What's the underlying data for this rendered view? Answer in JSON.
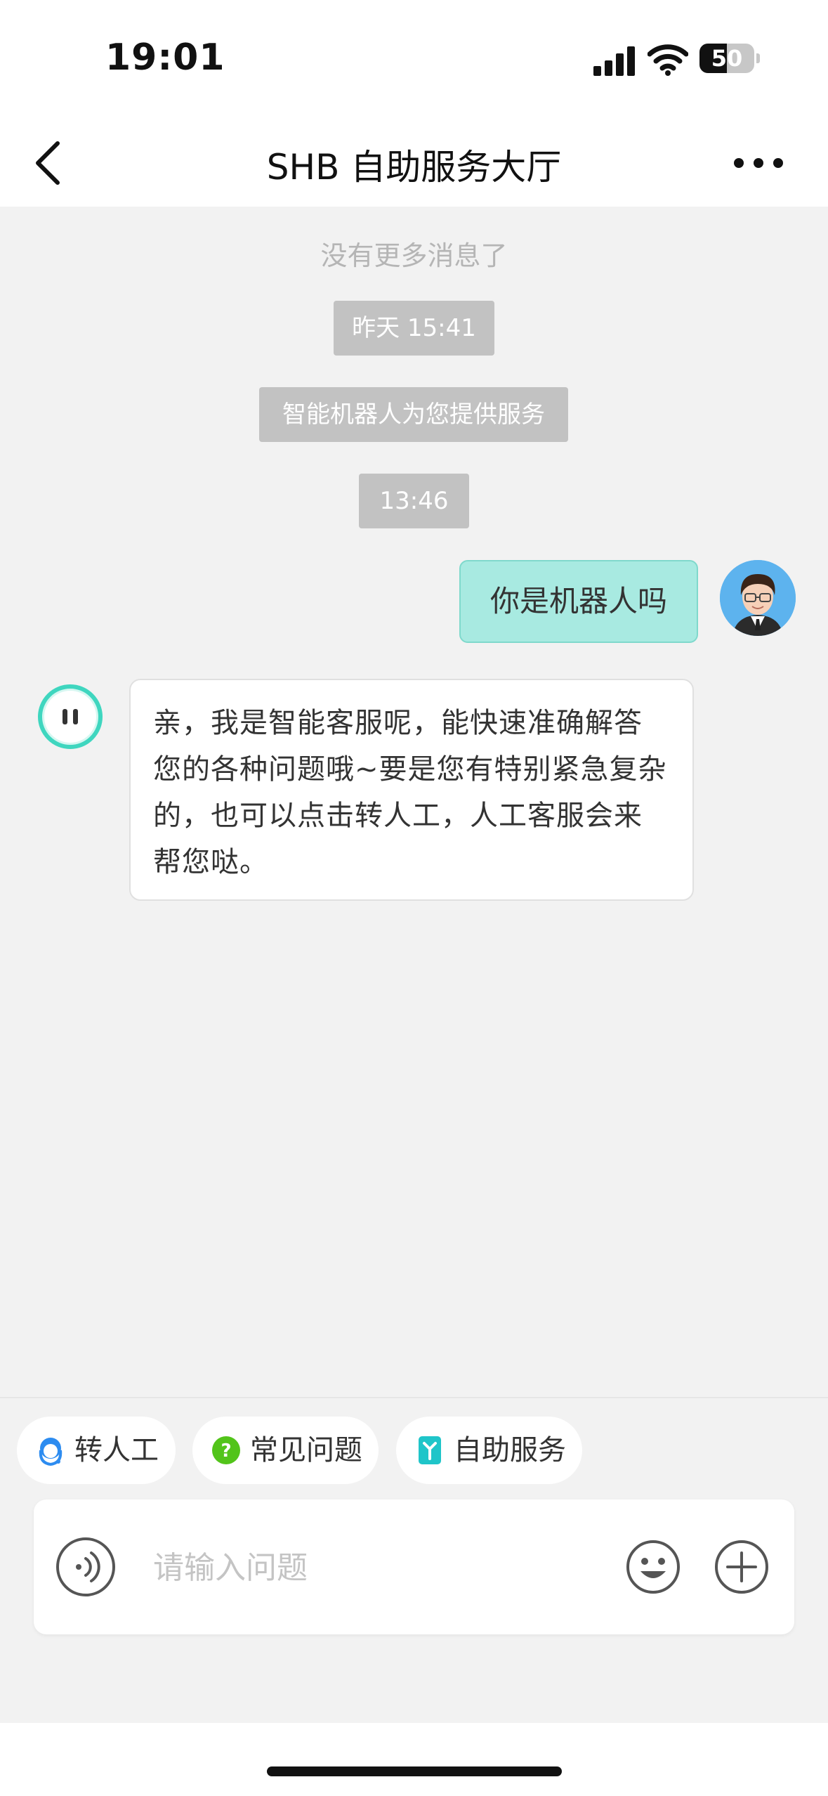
{
  "status_bar": {
    "time": "19:01",
    "battery": "50",
    "battery_level": 0.5
  },
  "navbar": {
    "title": "SHB 自助服务大厅",
    "back_icon": "chevron-left-icon",
    "more_icon": "more-dots-icon"
  },
  "chat": {
    "no_more": "没有更多消息了",
    "timestamp_1": "昨天 15:41",
    "service_notice": "智能机器人为您提供服务",
    "timestamp_2": "13:46",
    "user_message": "你是机器人吗",
    "bot_message": "亲，我是智能客服呢，能快速准确解答您的各种问题哦~要是您有特别紧急复杂的，也可以点击转人工，人工客服会来帮您哒。"
  },
  "quick_actions": [
    {
      "label": "转人工",
      "icon": "agent-icon",
      "color": "#2d8cf0"
    },
    {
      "label": "常见问题",
      "icon": "question-icon",
      "color": "#52c41a"
    },
    {
      "label": "自助服务",
      "icon": "self-service-icon",
      "color": "#1fc5c9"
    }
  ],
  "input": {
    "placeholder": "请输入问题"
  },
  "colors": {
    "user_bubble": "#a8eae1",
    "bot_avatar_ring": "#3fd6bf",
    "background": "#f2f2f2"
  }
}
